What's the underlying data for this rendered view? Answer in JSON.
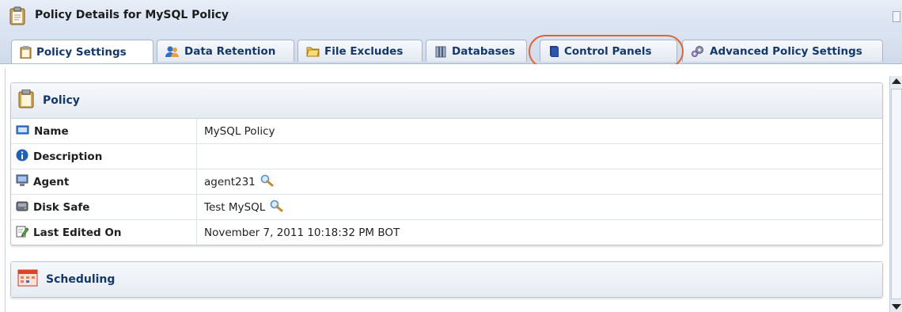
{
  "window": {
    "title": "Policy Details for MySQL Policy"
  },
  "tabs": [
    {
      "label": "Policy Settings",
      "icon": "clipboard-icon",
      "active": true
    },
    {
      "label": "Data Retention",
      "icon": "users-icon",
      "active": false
    },
    {
      "label": "File Excludes",
      "icon": "folder-icon",
      "active": false
    },
    {
      "label": "Databases",
      "icon": "database-icon",
      "active": false
    },
    {
      "label": "Control Panels",
      "icon": "book-icon",
      "active": false,
      "highlighted": true
    },
    {
      "label": "Advanced Policy Settings",
      "icon": "gears-icon",
      "active": false
    }
  ],
  "policy": {
    "title": "Policy",
    "rows": [
      {
        "label": "Name",
        "icon": "tag-icon",
        "value": "MySQL Policy"
      },
      {
        "label": "Description",
        "icon": "info-icon",
        "value": ""
      },
      {
        "label": "Agent",
        "icon": "computer-icon",
        "value": "agent231",
        "lookup": true
      },
      {
        "label": "Disk Safe",
        "icon": "disk-icon",
        "value": "Test MySQL",
        "lookup": true
      },
      {
        "label": "Last Edited On",
        "icon": "edit-icon",
        "value": "November 7, 2011 10:18:32 PM BOT"
      }
    ]
  },
  "scheduling": {
    "title": "Scheduling"
  },
  "colors": {
    "tab_text": "#13386c",
    "highlight_ring": "#e2642e",
    "header_bg": "#d7e1f0"
  }
}
